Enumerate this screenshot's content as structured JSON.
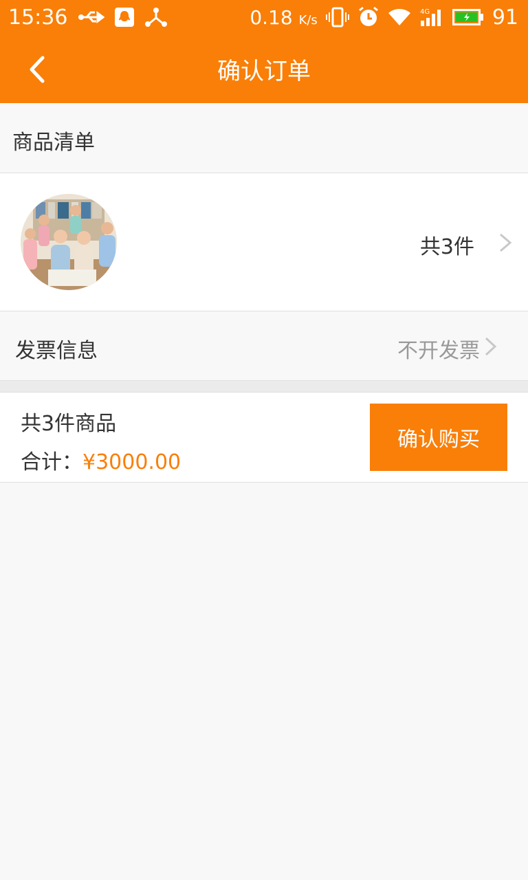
{
  "status_bar": {
    "time": "15:36",
    "net_speed": "0.18",
    "net_unit": "K/s",
    "signal_type": "4G",
    "battery": "91",
    "icons": [
      "usb-icon",
      "qq-icon",
      "share-icon",
      "vibrate-icon",
      "alarm-icon",
      "wifi-icon",
      "signal-icon",
      "battery-icon"
    ]
  },
  "header": {
    "title": "确认订单",
    "back_icon": "chevron-left-icon"
  },
  "goods": {
    "section_title": "商品清单",
    "count_label": "共3件"
  },
  "invoice": {
    "label": "发票信息",
    "value": "不开发票"
  },
  "summary": {
    "count_text": "共3件商品",
    "total_label": "合计：",
    "total_value": "¥3000.00",
    "buy_label": "确认购买"
  },
  "colors": {
    "accent": "#f97f08",
    "background": "#f8f8f8",
    "muted_text": "#999999"
  }
}
